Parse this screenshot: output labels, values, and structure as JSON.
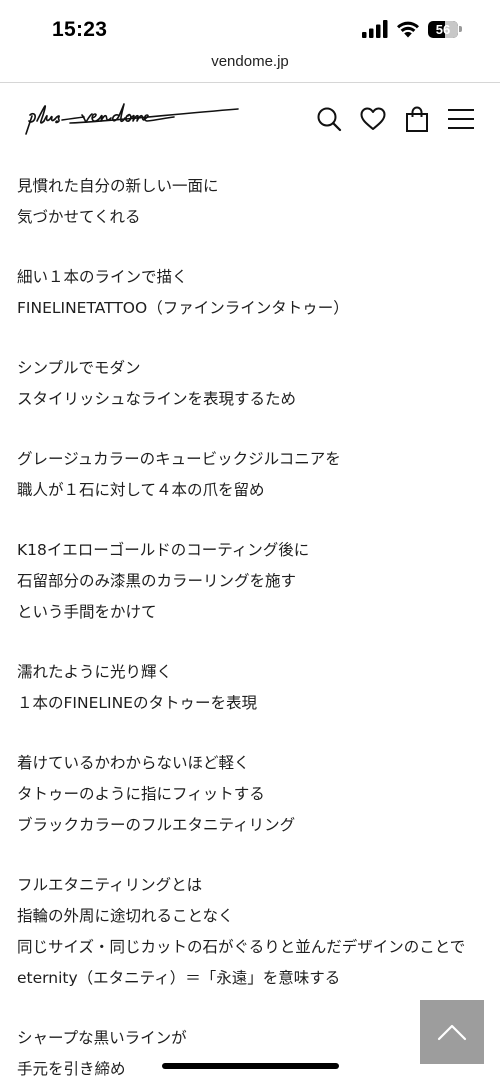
{
  "status_bar": {
    "time": "15:23",
    "battery_level": "56",
    "battery_fraction": 0.56
  },
  "browser": {
    "url": "vendome.jp"
  },
  "header": {
    "logo_text": "plus vendome",
    "icons": [
      "search-icon",
      "heart-icon",
      "shopping-bag-icon",
      "menu-icon"
    ]
  },
  "article": {
    "paragraphs": [
      [
        "見慣れた自分の新しい一面に",
        "気づかせてくれる"
      ],
      [
        "細い１本のラインで描く",
        "FINELINETATTOO（ファインラインタトゥー）"
      ],
      [
        "シンプルでモダン",
        "スタイリッシュなラインを表現するため"
      ],
      [
        "グレージュカラーのキュービックジルコニアを",
        "職人が１石に対して４本の爪を留め"
      ],
      [
        "K18イエローゴールドのコーティング後に",
        "石留部分のみ漆黒のカラーリングを施す",
        "という手間をかけて"
      ],
      [
        "濡れたように光り輝く",
        "１本のFINELINEのタトゥーを表現"
      ],
      [
        "着けているかわからないほど軽く",
        "タトゥーのように指にフィットする",
        "ブラックカラーのフルエタニティリング"
      ],
      [
        "フルエタニティリングとは",
        "指輪の外周に途切れることなく",
        "同じサイズ・同じカットの石がぐるりと並んだデザインのことで",
        "eternity（エタニティ）＝「永遠」を意味する"
      ],
      [
        "シャープな黒いラインが",
        "手元を引き締め"
      ]
    ]
  },
  "colors": {
    "back_to_top_bg": "#9d9d9d",
    "text": "#1e1e1e"
  }
}
